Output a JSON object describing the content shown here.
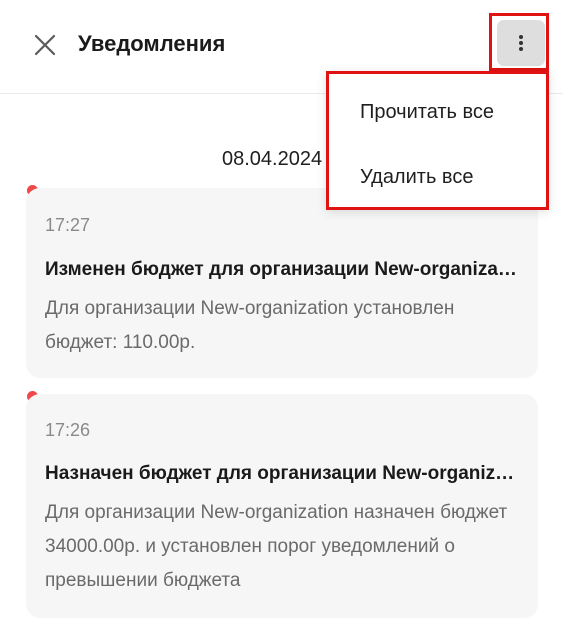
{
  "header": {
    "title": "Уведомления"
  },
  "menu": {
    "items": [
      {
        "label": "Прочитать все"
      },
      {
        "label": "Удалить все"
      }
    ]
  },
  "date_group": "08.04.2024",
  "notifications": [
    {
      "time": "17:27",
      "title": "Изменен бюджет для организации New-organization",
      "body": "Для организации New-organization установлен бюджет: 110.00р.",
      "unread": true
    },
    {
      "time": "17:26",
      "title": "Назначен бюджет для организации New-organization",
      "body": "Для организации New-organization назначен бюджет 34000.00р. и установлен порог уведомлений о превышении бюджета",
      "unread": true
    }
  ],
  "colors": {
    "unread_dot": "#f04848",
    "highlight": "#e01212",
    "card_bg": "#f6f6f6"
  },
  "icons": {
    "close": "close-icon",
    "more": "more-vertical-icon"
  }
}
